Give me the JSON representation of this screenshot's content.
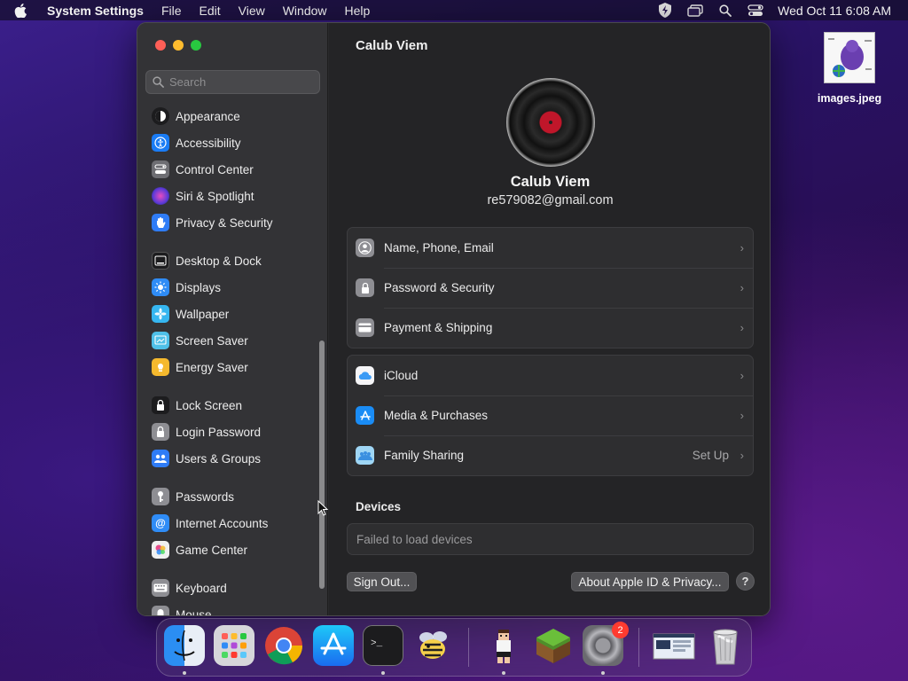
{
  "menubar": {
    "app_name": "System Settings",
    "menus": [
      "File",
      "Edit",
      "View",
      "Window",
      "Help"
    ],
    "clock": "Wed Oct 11  6:08 AM"
  },
  "desktop": {
    "file_label": "images.jpeg"
  },
  "sidebar": {
    "search_placeholder": "Search",
    "items": [
      {
        "label": "Appearance",
        "icon": "appearance-icon",
        "color": "#1c1c1e"
      },
      {
        "label": "Accessibility",
        "icon": "accessibility-icon",
        "color": "#1a7cf5"
      },
      {
        "label": "Control Center",
        "icon": "control-center-icon",
        "color": "#6e6e73"
      },
      {
        "label": "Siri & Spotlight",
        "icon": "siri-icon",
        "color": "#b04ad8"
      },
      {
        "label": "Privacy & Security",
        "icon": "hand-icon",
        "color": "#2f7cf6"
      },
      {
        "label": "Desktop & Dock",
        "icon": "dock-icon",
        "color": "#1c1c1e"
      },
      {
        "label": "Displays",
        "icon": "displays-icon",
        "color": "#2f8cf6"
      },
      {
        "label": "Wallpaper",
        "icon": "wallpaper-icon",
        "color": "#36b6f0"
      },
      {
        "label": "Screen Saver",
        "icon": "screen-saver-icon",
        "color": "#4fc0e8"
      },
      {
        "label": "Energy Saver",
        "icon": "battery-icon",
        "color": "#f5b92e"
      },
      {
        "label": "Lock Screen",
        "icon": "lock-icon",
        "color": "#1c1c1e"
      },
      {
        "label": "Login Password",
        "icon": "lock-icon",
        "color": "#8e8e93"
      },
      {
        "label": "Users & Groups",
        "icon": "users-icon",
        "color": "#2f7cf6"
      },
      {
        "label": "Passwords",
        "icon": "key-icon",
        "color": "#8e8e93"
      },
      {
        "label": "Internet Accounts",
        "icon": "at-icon",
        "color": "#2f8cf6"
      },
      {
        "label": "Game Center",
        "icon": "game-center-icon",
        "color": "#e0e0e0"
      },
      {
        "label": "Keyboard",
        "icon": "keyboard-icon",
        "color": "#8e8e93"
      },
      {
        "label": "Mouse",
        "icon": "mouse-icon",
        "color": "#8e8e93"
      }
    ]
  },
  "content": {
    "title": "Calub Viem",
    "profile_name": "Calub Viem",
    "profile_email": "re579082@gmail.com",
    "group1": [
      {
        "label": "Name, Phone, Email",
        "icon": "person-icon",
        "color": "#8e8e93"
      },
      {
        "label": "Password & Security",
        "icon": "lock-icon",
        "color": "#8e8e93"
      },
      {
        "label": "Payment & Shipping",
        "icon": "card-icon",
        "color": "#8e8e93"
      }
    ],
    "group2": [
      {
        "label": "iCloud",
        "icon": "icloud-icon",
        "color": "#f5f5f7",
        "extra": ""
      },
      {
        "label": "Media & Purchases",
        "icon": "app-store-icon",
        "color": "#1a8cf5",
        "extra": ""
      },
      {
        "label": "Family Sharing",
        "icon": "family-icon",
        "color": "#9fd6f5",
        "extra": "Set Up"
      }
    ],
    "devices_title": "Devices",
    "devices_status": "Failed to load devices",
    "sign_out": "Sign Out...",
    "about": "About Apple ID & Privacy...",
    "help": "?"
  },
  "dock": {
    "items": [
      {
        "name": "finder",
        "color": "#2a8cf0"
      },
      {
        "name": "launchpad",
        "color": "#c8c8cc"
      },
      {
        "name": "chrome",
        "color": "#ffffff"
      },
      {
        "name": "app-store",
        "color": "#1a8cf5"
      },
      {
        "name": "terminal",
        "color": "#1c1c1e"
      },
      {
        "name": "bee-app",
        "color": "#f5d04a"
      },
      {
        "name": "character-app",
        "color": "#f1c9a5"
      },
      {
        "name": "minecraft",
        "color": "#5a9a3a"
      },
      {
        "name": "system-settings",
        "color": "#8e8e93",
        "badge": "2"
      },
      {
        "name": "window-preview",
        "color": "#d8dfe8"
      },
      {
        "name": "trash",
        "color": "#c9c9cc"
      }
    ]
  }
}
